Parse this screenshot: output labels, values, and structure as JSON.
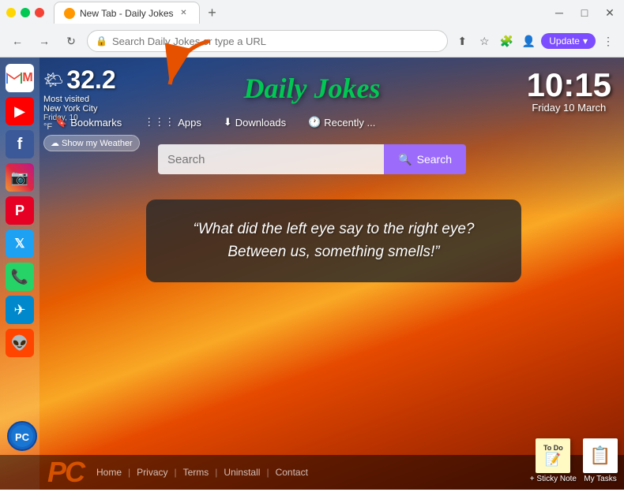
{
  "browser": {
    "tab_title": "New Tab - Daily Jokes",
    "address_placeholder": "Search Daily Jokes or type a URL",
    "new_tab_label": "+",
    "update_btn": "Update",
    "nav": {
      "back": "←",
      "forward": "→",
      "refresh": "↻"
    }
  },
  "toolbar": {
    "bookmarks": "Bookmarks",
    "apps": "Apps",
    "downloads": "Downloads",
    "recently": "Recently ..."
  },
  "weather": {
    "temp": "32.2",
    "icon": "🌤",
    "location": "Most visited\nNew York City",
    "date": "Friday, 10",
    "unit": "°F",
    "show_btn": "☁ Show my Weather"
  },
  "clock": {
    "time": "10:15",
    "date": "Friday 10 March"
  },
  "search": {
    "placeholder": "Search",
    "btn_label": "Search"
  },
  "joke": {
    "text": "“What did the left eye say to the right eye? Between us, something smells!”"
  },
  "site_title": "Daily Jokes",
  "social_icons": [
    {
      "name": "gmail",
      "symbol": "M",
      "label": "Gmail"
    },
    {
      "name": "youtube",
      "symbol": "▶",
      "label": "YouTube"
    },
    {
      "name": "facebook",
      "symbol": "f",
      "label": "Facebook"
    },
    {
      "name": "instagram",
      "symbol": "📷",
      "label": "Instagram"
    },
    {
      "name": "pinterest",
      "symbol": "P",
      "label": "Pinterest"
    },
    {
      "name": "twitter",
      "symbol": "🐦",
      "label": "Twitter"
    },
    {
      "name": "whatsapp",
      "symbol": "📞",
      "label": "WhatsApp"
    },
    {
      "name": "telegram",
      "symbol": "✈",
      "label": "Telegram"
    },
    {
      "name": "reddit",
      "symbol": "👽",
      "label": "Reddit"
    }
  ],
  "bottom": {
    "links": [
      "Home",
      "Privacy",
      "Terms",
      "Uninstall",
      "Contact"
    ],
    "separators": [
      "|",
      "|",
      "|",
      "|"
    ]
  },
  "tools": {
    "sticky_note_title": "To Do",
    "sticky_note_label": "+ Sticky Note",
    "tasks_label": "My Tasks"
  }
}
